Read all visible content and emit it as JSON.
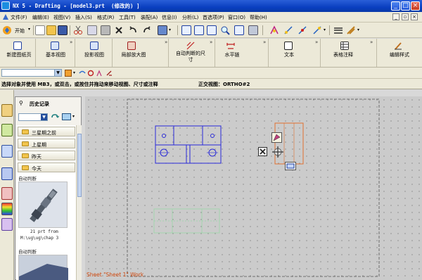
{
  "window": {
    "title": "NX 5 - Drafting - [model3.prt  (修改的) ]",
    "minimize_label": "_",
    "maximize_label": "□",
    "close_label": "×"
  },
  "menubar": {
    "items": [
      "文件(F)",
      "编辑(E)",
      "视图(V)",
      "插入(S)",
      "格式(R)",
      "工具(T)",
      "装配(A)",
      "信息(I)",
      "分析(L)",
      "首选项(P)",
      "窗口(O)",
      "帮助(H)"
    ]
  },
  "toolbar": {
    "start_label": "开始"
  },
  "ribbon": {
    "new_sheet": "新建图纸页",
    "base_view": "基本视图",
    "projected_view": "投影视图",
    "detail_view": "局部放大图",
    "auto_dimension": "自动判断的尺寸",
    "horizontal": "水平链",
    "note": "文本",
    "tabular_note": "表格注释",
    "edit_style": "编辑样式"
  },
  "cue_line": {
    "prompt": "选择对象并使用 MB3，或双击，或按住并拖动来移动视图、尺寸或注释",
    "status": "正交视图：ORTHO#2"
  },
  "history": {
    "title": "历史记录",
    "folders": [
      "三星期之前",
      "上星期",
      "昨天",
      "今天"
    ],
    "auto_label_1": "自动判断",
    "thumb_caption_1": "21 prt from",
    "thumb_caption_2": "M:\\ug\\ug\\chap 3",
    "auto_label_2": "自动判断"
  },
  "canvas": {
    "sheet_label": "Sheet \"Sheet 1\" Work"
  },
  "colors": {
    "title_bar": "#0a3fc0",
    "view_lines": "#2a2ad8",
    "border_orange": "#e07030",
    "sheet_label": "#d04a10"
  }
}
